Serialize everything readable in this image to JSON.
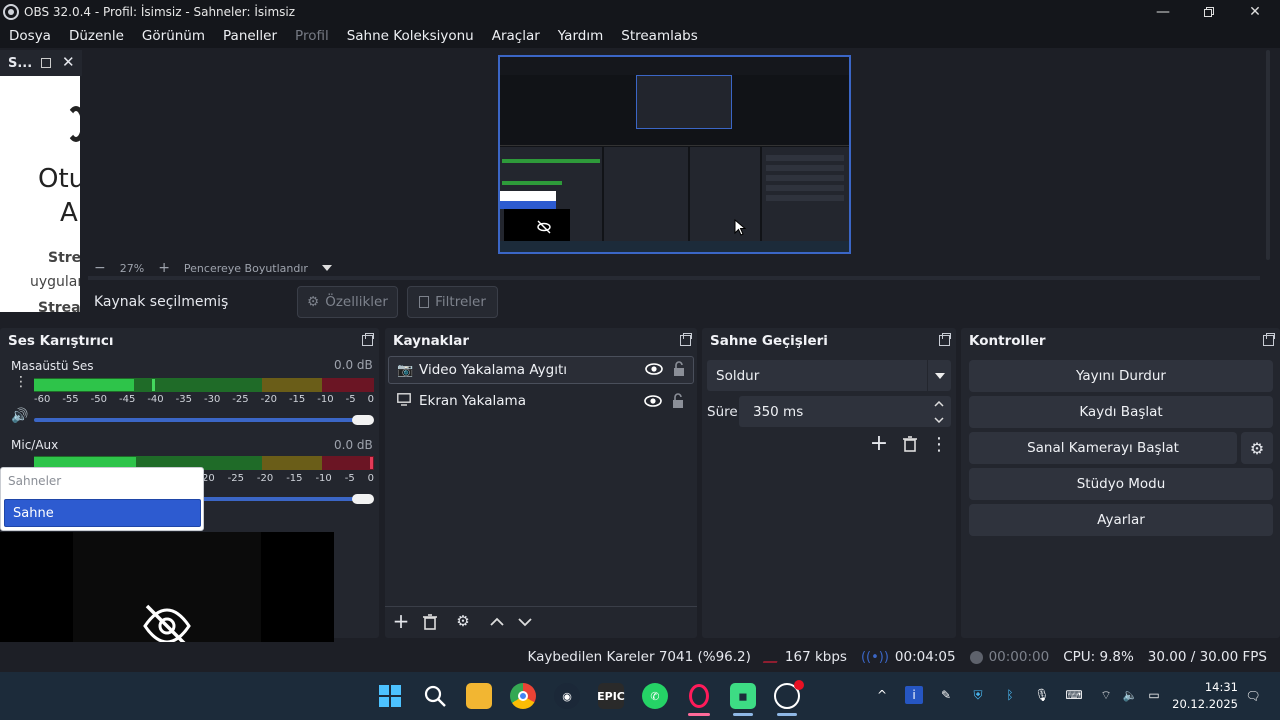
{
  "window": {
    "title": "OBS 32.0.4 - Profil: İsimsiz - Sahneler: İsimsiz",
    "controls": [
      "minimize",
      "maximize",
      "close"
    ]
  },
  "menu": {
    "items": [
      {
        "label": "Dosya",
        "enabled": true
      },
      {
        "label": "Düzenle",
        "enabled": true
      },
      {
        "label": "Görünüm",
        "enabled": true
      },
      {
        "label": "Paneller",
        "enabled": true
      },
      {
        "label": "Profil",
        "enabled": false
      },
      {
        "label": "Sahne Koleksiyonu",
        "enabled": true
      },
      {
        "label": "Araçlar",
        "enabled": true
      },
      {
        "label": "Yardım",
        "enabled": true
      },
      {
        "label": "Streamlabs",
        "enabled": true
      }
    ]
  },
  "scene_dock": {
    "title": "S...",
    "preview_text": {
      "line1": "Otu",
      "line2": "A",
      "line3": "Strea",
      "line4": "uygular",
      "line5": "Strea"
    }
  },
  "preview": {
    "zoom": "27%",
    "zoom_minus": "−",
    "zoom_plus": "+",
    "fit_label": "Pencereye Boyutlandır"
  },
  "context_bar": {
    "no_source": "Kaynak seçilmemiş",
    "properties": "Özellikler",
    "filters": "Filtreler"
  },
  "mixer": {
    "title": "Ses Karıştırıcı",
    "channels": [
      {
        "name": "Masaüstü Ses",
        "db": "0.0 dB",
        "level": 0.42,
        "peak": 0.45,
        "volume": 1.0
      },
      {
        "name": "Mic/Aux",
        "db": "0.0 dB",
        "level": 0.28,
        "peak": 0.98,
        "volume": 1.0
      }
    ],
    "ticks": [
      "-60",
      "-55",
      "-50",
      "-45",
      "-40",
      "-35",
      "-30",
      "-25",
      "-20",
      "-15",
      "-10",
      "-5",
      "0"
    ],
    "ticks_partial": [
      "20",
      "-25",
      "-20",
      "-15",
      "-10",
      "-5",
      "0"
    ]
  },
  "sources": {
    "title": "Kaynaklar",
    "items": [
      {
        "label": "Video Yakalama Aygıtı",
        "icon": "camera-icon",
        "selected": true
      },
      {
        "label": "Ekran Yakalama",
        "icon": "monitor-icon",
        "selected": false
      }
    ]
  },
  "transitions": {
    "title": "Sahne Geçişleri",
    "type": "Soldur",
    "duration_label": "Süre",
    "duration_value": "350 ms"
  },
  "controls": {
    "title": "Kontroller",
    "buttons": [
      "Yayını Durdur",
      "Kaydı Başlat",
      "Sanal Kamerayı Başlat",
      "Stüdyo Modu",
      "Ayarlar"
    ]
  },
  "scene_popup": {
    "header": "Sahneler",
    "item": "Sahne"
  },
  "status": {
    "dropped": "Kaybedilen Kareler 7041 (%96.2)",
    "bitrate": "167 kbps",
    "stream_time": "00:04:05",
    "record_time": "00:00:00",
    "cpu": "CPU: 9.8%",
    "fps": "30.00 / 30.00 FPS"
  },
  "taskbar": {
    "time": "14:31",
    "date": "20.12.2025",
    "epic_label": "EPIC"
  },
  "colors": {
    "accent": "#3b66c6",
    "meter_green": "#2e9a3a",
    "meter_yellow": "#8a7d22",
    "meter_red": "#8e1e30",
    "stream_indicator": "#3b66c6"
  }
}
